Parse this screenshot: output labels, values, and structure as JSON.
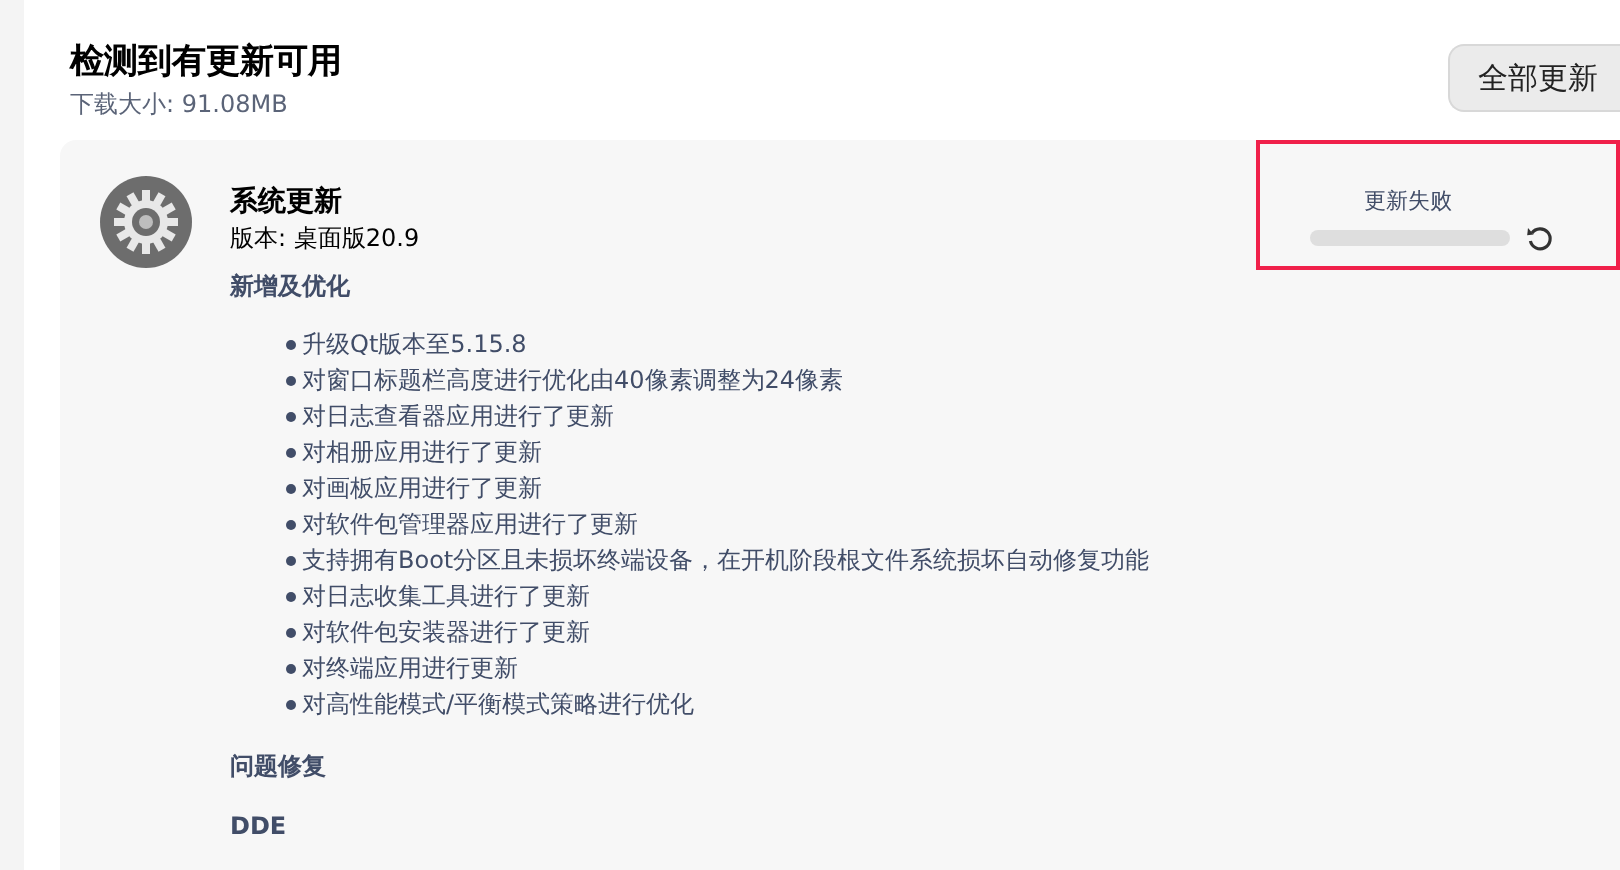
{
  "header": {
    "title": "检测到有更新可用",
    "download_size": "下载大小: 91.08MB",
    "update_all_button": "全部更新"
  },
  "update": {
    "name": "系统更新",
    "version": "版本: 桌面版20.9",
    "status": "更新失败",
    "level": 0,
    "sections": [
      {
        "heading": "新增及优化",
        "items": [
          "升级Qt版本至5.15.8",
          "对窗口标题栏高度进行优化由40像素调整为24像素",
          "对日志查看器应用进行了更新",
          "对相册应用进行了更新",
          "对画板应用进行了更新",
          "对软件包管理器应用进行了更新",
          "支持拥有Boot分区且未损坏终端设备，在开机阶段根文件系统损坏自动修复功能",
          "对日志收集工具进行了更新",
          "对软件包安装器进行了更新",
          "对终端应用进行更新",
          "对高性能模式/平衡模式策略进行优化"
        ]
      },
      {
        "heading": "问题修复"
      },
      {
        "heading": "DDE"
      }
    ]
  }
}
